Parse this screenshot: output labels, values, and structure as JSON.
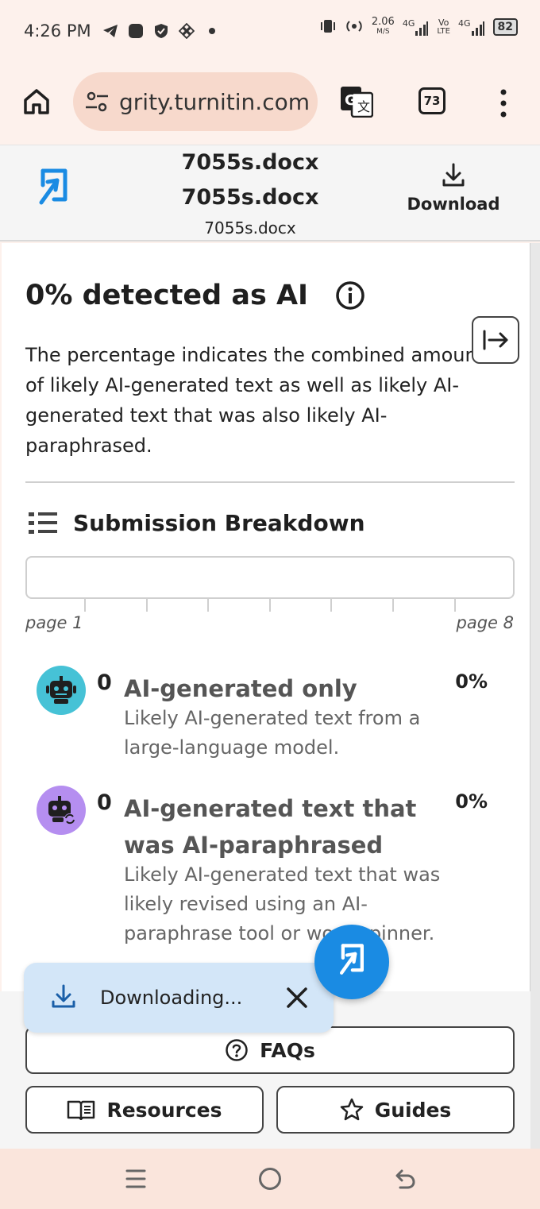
{
  "status_bar": {
    "time": "4:26 PM",
    "net_speed_top": "2.06",
    "net_speed_bottom": "M/S",
    "net_type1": "4G",
    "volte_top": "Vo",
    "volte_bottom": "LTE",
    "net_type2": "4G",
    "battery": "82"
  },
  "browser": {
    "url": "grity.turnitin.com",
    "tab_count": "73"
  },
  "doc_header": {
    "title_line1": "7055s.docx",
    "title_line2": "7055s.docx",
    "filename": "7055s.docx",
    "download_label": "Download"
  },
  "report": {
    "heading": "0% detected as AI",
    "description": "The percentage indicates the combined amount of likely AI-generated text as well as likely AI-generated text that was also likely AI-paraphrased.",
    "breakdown_title": "Submission Breakdown",
    "page_start": "page 1",
    "page_end": "page 8",
    "items": [
      {
        "count": "0",
        "title": "AI-generated only",
        "percent": "0%",
        "description": "Likely AI-generated text from a large-language model.",
        "avatar_color": "#46c2d6"
      },
      {
        "count": "0",
        "title": "AI-generated text that was AI-paraphrased",
        "percent": "0%",
        "description": "Likely AI-generated text that was likely revised using an AI-paraphrase tool or word spinner.",
        "avatar_color": "#b58ef0"
      }
    ]
  },
  "bottom_buttons": {
    "faqs": "FAQs",
    "resources": "Resources",
    "guides": "Guides"
  },
  "toast": {
    "label": "Downloading..."
  },
  "colors": {
    "accent": "#1a8be3",
    "browser_bg": "#fdf1ec",
    "url_pill": "#f7d9cc",
    "toast_bg": "#d3e6f8"
  }
}
